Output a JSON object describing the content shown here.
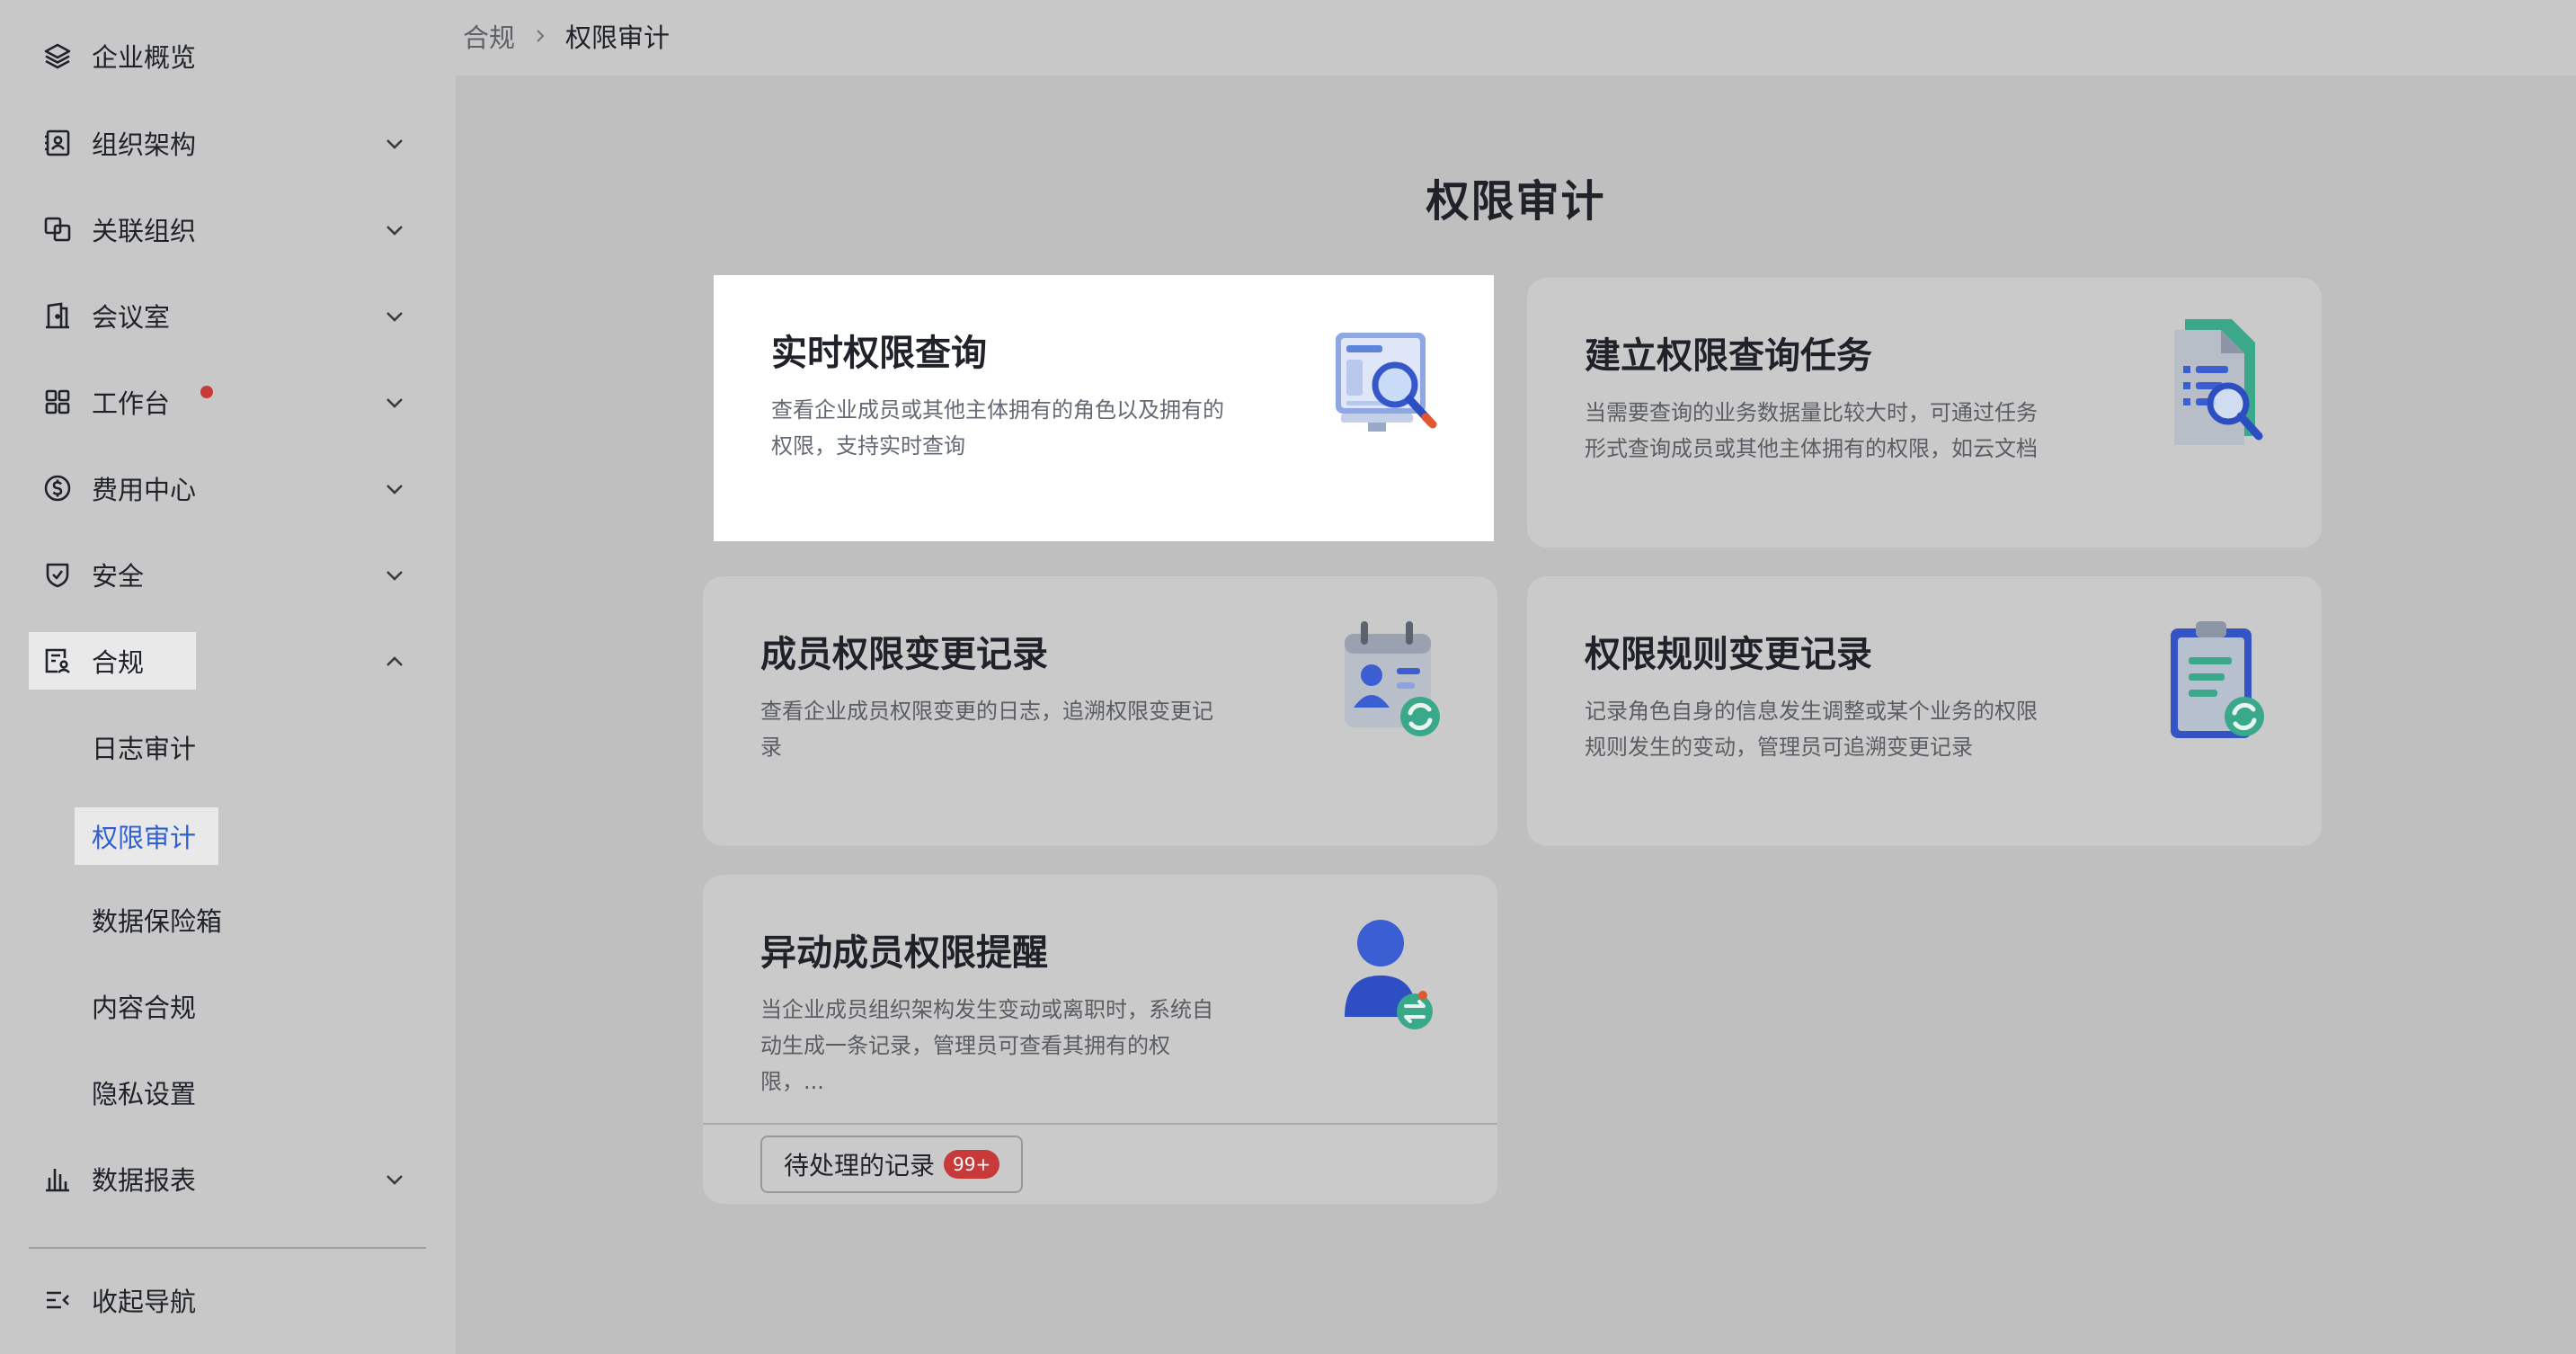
{
  "sidebar": {
    "items": [
      {
        "label": "企业概览",
        "icon": "layers-icon"
      },
      {
        "label": "组织架构",
        "icon": "contact-book-icon"
      },
      {
        "label": "关联组织",
        "icon": "linked-org-icon"
      },
      {
        "label": "会议室",
        "icon": "meeting-room-icon"
      },
      {
        "label": "工作台",
        "icon": "grid-icon"
      },
      {
        "label": "费用中心",
        "icon": "dollar-icon"
      },
      {
        "label": "安全",
        "icon": "shield-icon"
      },
      {
        "label": "合规",
        "icon": "compliance-icon"
      },
      {
        "label": "数据报表",
        "icon": "bar-chart-icon"
      }
    ],
    "sub_items": [
      "日志审计",
      "权限审计",
      "数据保险箱",
      "内容合规",
      "隐私设置"
    ],
    "collapse_label": "收起导航"
  },
  "breadcrumb": {
    "parent": "合规",
    "current": "权限审计"
  },
  "page_title": "权限审计",
  "cards": [
    {
      "title": "实时权限查询",
      "desc": "查看企业成员或其他主体拥有的角色以及拥有的权限，支持实时查询"
    },
    {
      "title": "建立权限查询任务",
      "desc": "当需要查询的业务数据量比较大时，可通过任务形式查询成员或其他主体拥有的权限，如云文档"
    },
    {
      "title": "成员权限变更记录",
      "desc": "查看企业成员权限变更的日志，追溯权限变更记录"
    },
    {
      "title": "权限规则变更记录",
      "desc": "记录角色自身的信息发生调整或某个业务的权限规则发生的变动，管理员可追溯变更记录"
    },
    {
      "title": "异动成员权限提醒",
      "desc": "当企业成员组织架构发生变动或离职时，系统自动生成一条记录，管理员可查看其拥有的权限，..."
    }
  ],
  "pending": {
    "label": "待处理的记录",
    "badge": "99+"
  },
  "colors": {
    "accent": "#2f5fd1",
    "badge_red": "#c8393a"
  }
}
